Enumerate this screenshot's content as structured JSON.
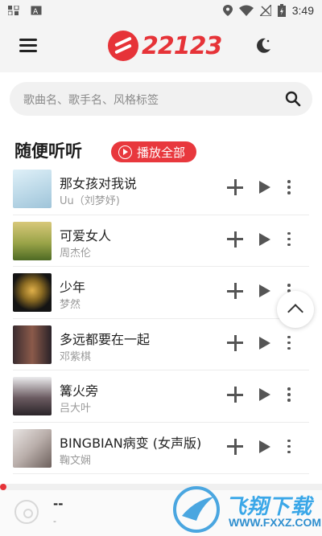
{
  "status_bar": {
    "time": "3:49",
    "icons": [
      "notification-icon",
      "keyboard-icon",
      "location-icon",
      "wifi-icon",
      "no-signal-icon",
      "battery-icon"
    ]
  },
  "header": {
    "logo_text": "22123",
    "brand_color": "#e63338",
    "icons": [
      "menu-icon",
      "moon-icon"
    ]
  },
  "search": {
    "placeholder": "歌曲名、歌手名、风格标签"
  },
  "section": {
    "title": "随便听听",
    "play_all_label": "播放全部"
  },
  "songs": [
    {
      "title": "那女孩对我说",
      "artist": "Uu（刘梦妤)",
      "cover_colors": [
        "#cfe5ef",
        "#b8d6e6"
      ]
    },
    {
      "title": "可爱女人",
      "artist": "周杰伦",
      "cover_colors": [
        "#c9b66a",
        "#5f7a2e"
      ]
    },
    {
      "title": "少年",
      "artist": "梦然",
      "cover_colors": [
        "#1a1a1a",
        "#d7a63a"
      ]
    },
    {
      "title": "多远都要在一起",
      "artist": "邓紫棋",
      "cover_colors": [
        "#2a2228",
        "#8b5a4a"
      ]
    },
    {
      "title": "篝火旁",
      "artist": "吕大叶",
      "cover_colors": [
        "#e8e8ea",
        "#3a3438"
      ]
    },
    {
      "title": "BINGBIAN病变 (女声版)",
      "artist": "鞠文娴",
      "cover_colors": [
        "#d9d4d2",
        "#7d6f6c"
      ]
    }
  ],
  "now_playing": {
    "title": "--",
    "artist": "-"
  },
  "watermark": {
    "title": "飞翔下载",
    "url": "WWW.FXXZ.COM"
  }
}
